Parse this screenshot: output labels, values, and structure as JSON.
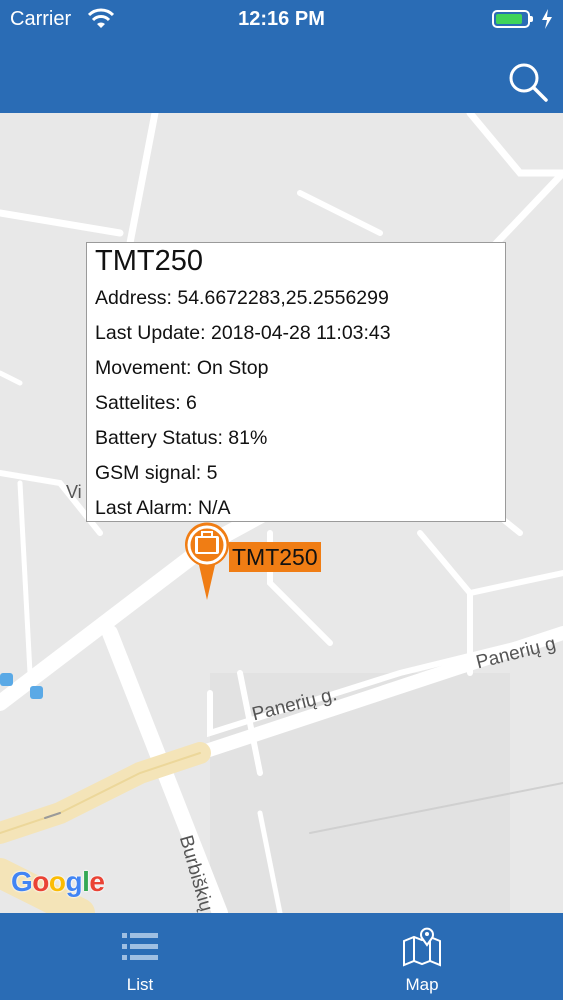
{
  "status_bar": {
    "carrier": "Carrier",
    "time": "12:16 PM"
  },
  "nav_bar": {
    "search_icon": "search-icon"
  },
  "map": {
    "street_labels": [
      "Panerių g.",
      "Panerių g",
      "Burbiškių",
      "Vi"
    ],
    "attribution": "Google",
    "marker": {
      "label": "TMT250",
      "icon": "briefcase-pin-icon",
      "color": "#f07d14"
    }
  },
  "info_window": {
    "title": "TMT250",
    "address": "Address: 54.6672283,25.2556299",
    "last_update": "Last Update: 2018-04-28 11:03:43",
    "movement": "Movement: On Stop",
    "satellites": "Sattelites: 6",
    "battery_status": "Battery Status: 81%",
    "gsm_signal": "GSM signal: 5",
    "last_alarm": "Last Alarm: N/A"
  },
  "tab_bar": {
    "tabs": [
      {
        "label": "List",
        "icon": "list-icon"
      },
      {
        "label": "Map",
        "icon": "map-icon"
      }
    ]
  },
  "colors": {
    "primary": "#2a6cb5",
    "marker": "#f07d14",
    "battery": "#3fd35a"
  }
}
